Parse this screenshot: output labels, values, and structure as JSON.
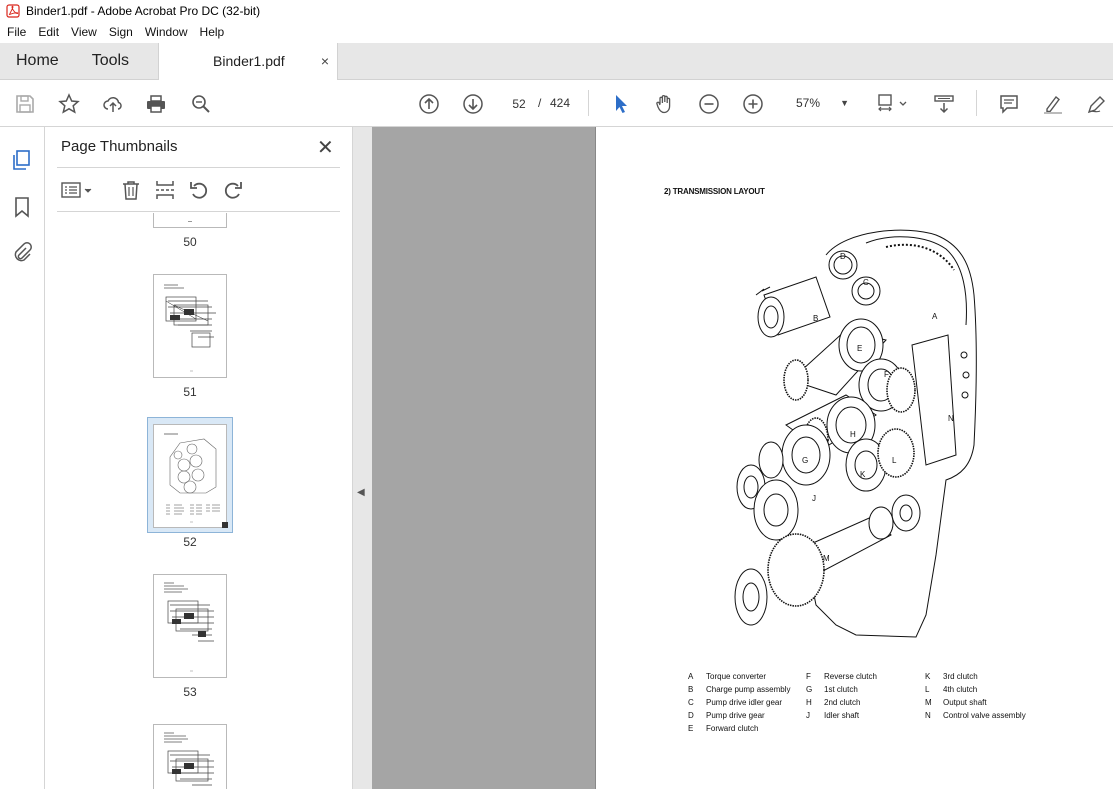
{
  "window": {
    "title": "Binder1.pdf - Adobe Acrobat Pro DC (32-bit)"
  },
  "menu": [
    "File",
    "Edit",
    "View",
    "Sign",
    "Window",
    "Help"
  ],
  "tabs": {
    "home": "Home",
    "tools": "Tools",
    "document": "Binder1.pdf",
    "close": "×"
  },
  "toolbar": {
    "page_current": "52",
    "page_separator": "/",
    "page_total": "424",
    "zoom": "57%"
  },
  "panel": {
    "title": "Page Thumbnails",
    "thumbnails": [
      {
        "label": "50"
      },
      {
        "label": "51"
      },
      {
        "label": "52",
        "selected": true
      },
      {
        "label": "53"
      }
    ]
  },
  "document": {
    "heading": "2) TRANSMISSION LAYOUT",
    "diagram_letters": [
      "A",
      "B",
      "C",
      "D",
      "E",
      "F",
      "G",
      "H",
      "J",
      "K",
      "L",
      "M",
      "N"
    ],
    "legend_col1": [
      {
        "key": "A",
        "text": "Torque converter"
      },
      {
        "key": "B",
        "text": "Charge pump assembly"
      },
      {
        "key": "C",
        "text": "Pump drive idler gear"
      },
      {
        "key": "D",
        "text": "Pump drive gear"
      },
      {
        "key": "E",
        "text": "Forward clutch"
      }
    ],
    "legend_col2": [
      {
        "key": "F",
        "text": "Reverse clutch"
      },
      {
        "key": "G",
        "text": "1st clutch"
      },
      {
        "key": "H",
        "text": "2nd clutch"
      },
      {
        "key": "J",
        "text": "Idler shaft"
      }
    ],
    "legend_col3": [
      {
        "key": "K",
        "text": "3rd clutch"
      },
      {
        "key": "L",
        "text": "4th clutch"
      },
      {
        "key": "M",
        "text": "Output shaft"
      },
      {
        "key": "N",
        "text": "Control valve assembly"
      }
    ]
  },
  "colors": {
    "accent": "#2d6ec8",
    "pdf_red": "#d9261c",
    "viewer_bg": "#a5a5a5"
  }
}
